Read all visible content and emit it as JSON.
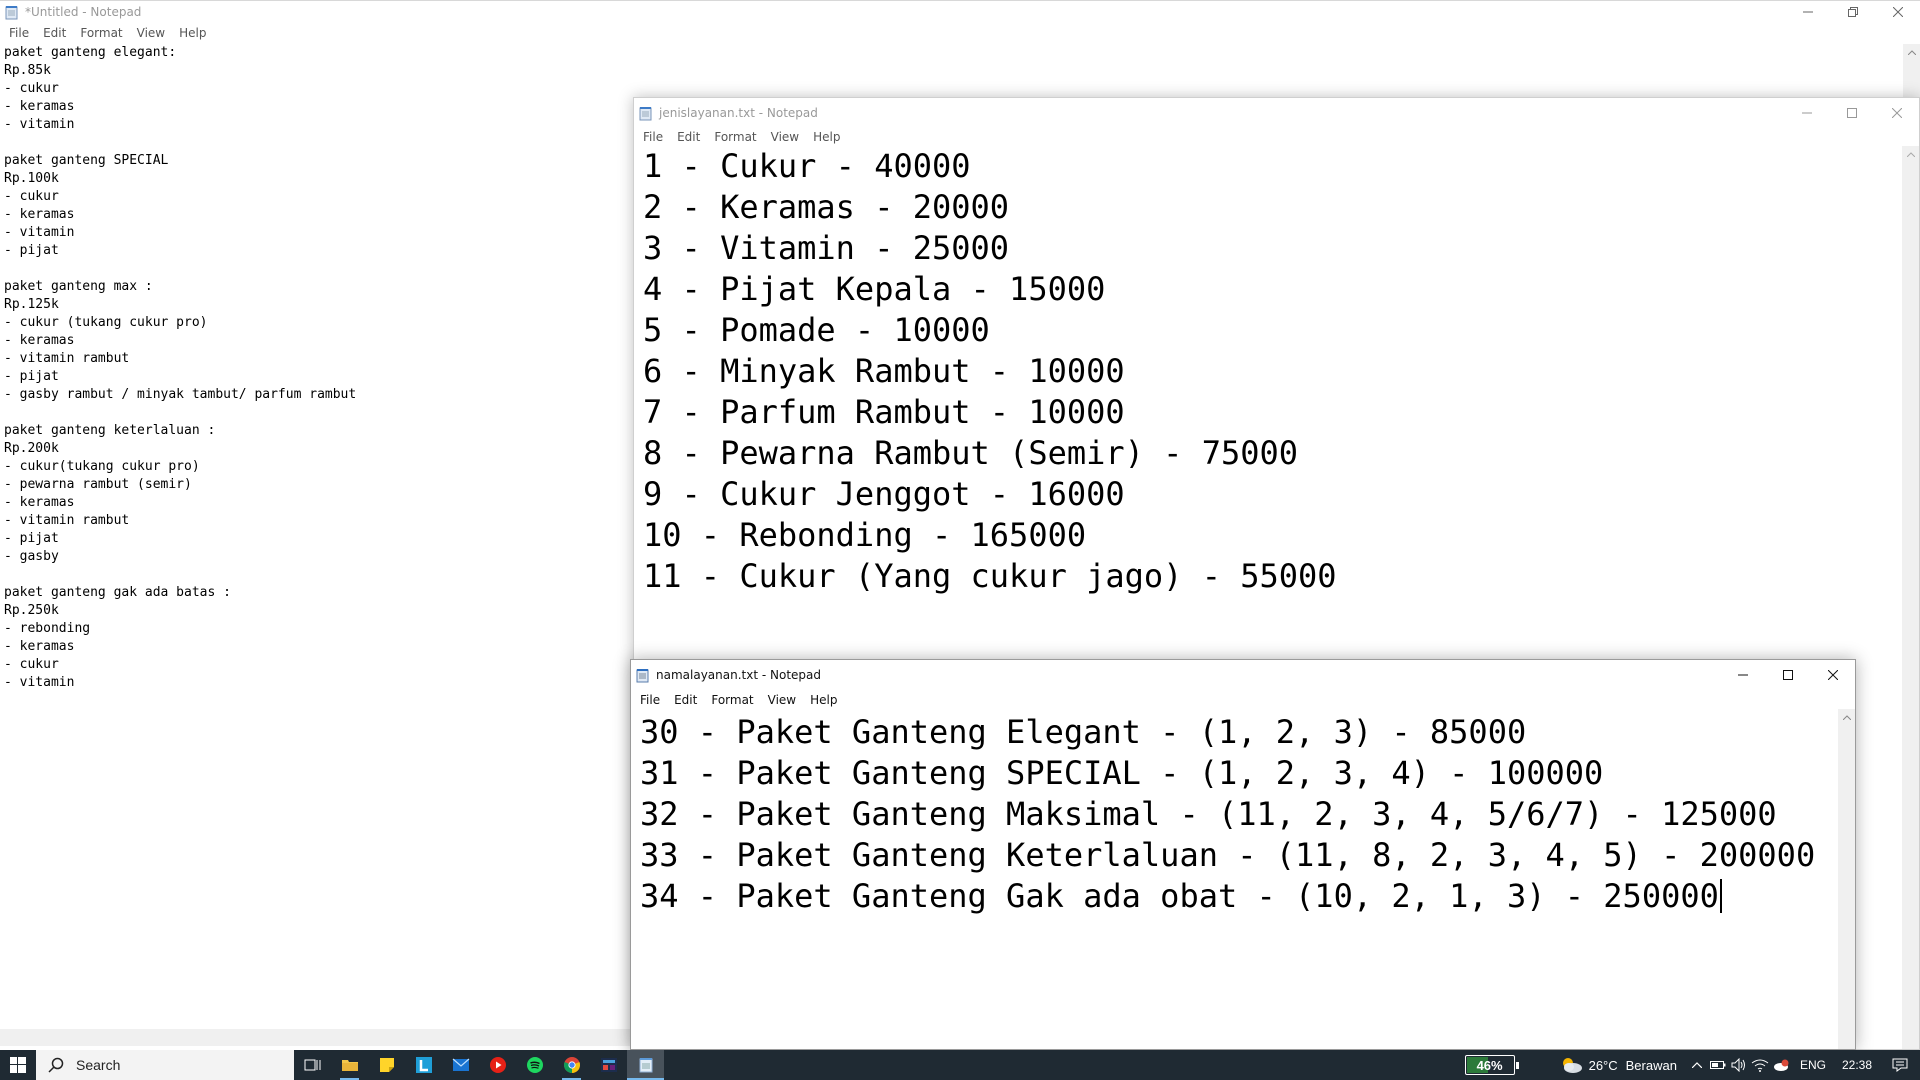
{
  "untitled": {
    "title": "*Untitled - Notepad",
    "menu": [
      "File",
      "Edit",
      "Format",
      "View",
      "Help"
    ],
    "lines": [
      "paket ganteng elegant:",
      "Rp.85k",
      "- cukur",
      "- keramas",
      "- vitamin",
      "",
      "paket ganteng SPECIAL",
      "Rp.100k",
      "- cukur",
      "- keramas",
      "- vitamin",
      "- pijat",
      "",
      "paket ganteng max :",
      "Rp.125k",
      "- cukur (tukang cukur pro)",
      "- keramas",
      "- vitamin rambut",
      "- pijat",
      "- gasby rambut / minyak tambut/ parfum rambut",
      "",
      "paket ganteng keterlaluan :",
      "Rp.200k",
      "- cukur(tukang cukur pro)",
      "- pewarna rambut (semir)",
      "- keramas",
      "- vitamin rambut",
      "- pijat",
      "- gasby",
      "",
      "paket ganteng gak ada batas :",
      "Rp.250k",
      "- rebonding",
      "- keramas",
      "- cukur",
      "- vitamin"
    ]
  },
  "jenis": {
    "title": "jenislayanan.txt - Notepad",
    "menu": [
      "File",
      "Edit",
      "Format",
      "View",
      "Help"
    ],
    "lines": [
      "1 - Cukur - 40000",
      "2 - Keramas - 20000",
      "3 - Vitamin - 25000",
      "4 - Pijat Kepala - 15000",
      "5 - Pomade - 10000",
      "6 - Minyak Rambut - 10000",
      "7 - Parfum Rambut - 10000",
      "8 - Pewarna Rambut (Semir) - 75000",
      "9 - Cukur Jenggot - 16000",
      "10 - Rebonding - 165000",
      "11 - Cukur (Yang cukur jago) - 55000"
    ]
  },
  "nama": {
    "title": "namalayanan.txt - Notepad",
    "menu": [
      "File",
      "Edit",
      "Format",
      "View",
      "Help"
    ],
    "lines": [
      "30 - Paket Ganteng Elegant - (1, 2, 3) - 85000",
      "31 - Paket Ganteng SPECIAL - (1, 2, 3, 4) - 100000",
      "32 - Paket Ganteng Maksimal - (11, 2, 3, 4, 5/6/7) - 125000",
      "33 - Paket Ganteng Keterlaluan - (11, 8, 2, 3, 4, 5) - 200000",
      "34 - Paket Ganteng Gak ada obat - (10, 2, 1, 3) - 250000"
    ]
  },
  "taskbar": {
    "search_label": "Search",
    "battery": "46%",
    "battery_level": 0.46,
    "temperature": "26°C",
    "weather": "Berawan",
    "language": "ENG",
    "time": "22:38",
    "apps": [
      "task-view",
      "file-explorer",
      "sticky-notes",
      "lightshot",
      "mail",
      "youtube",
      "spotify",
      "chrome",
      "visual-studio",
      "notepad"
    ]
  }
}
